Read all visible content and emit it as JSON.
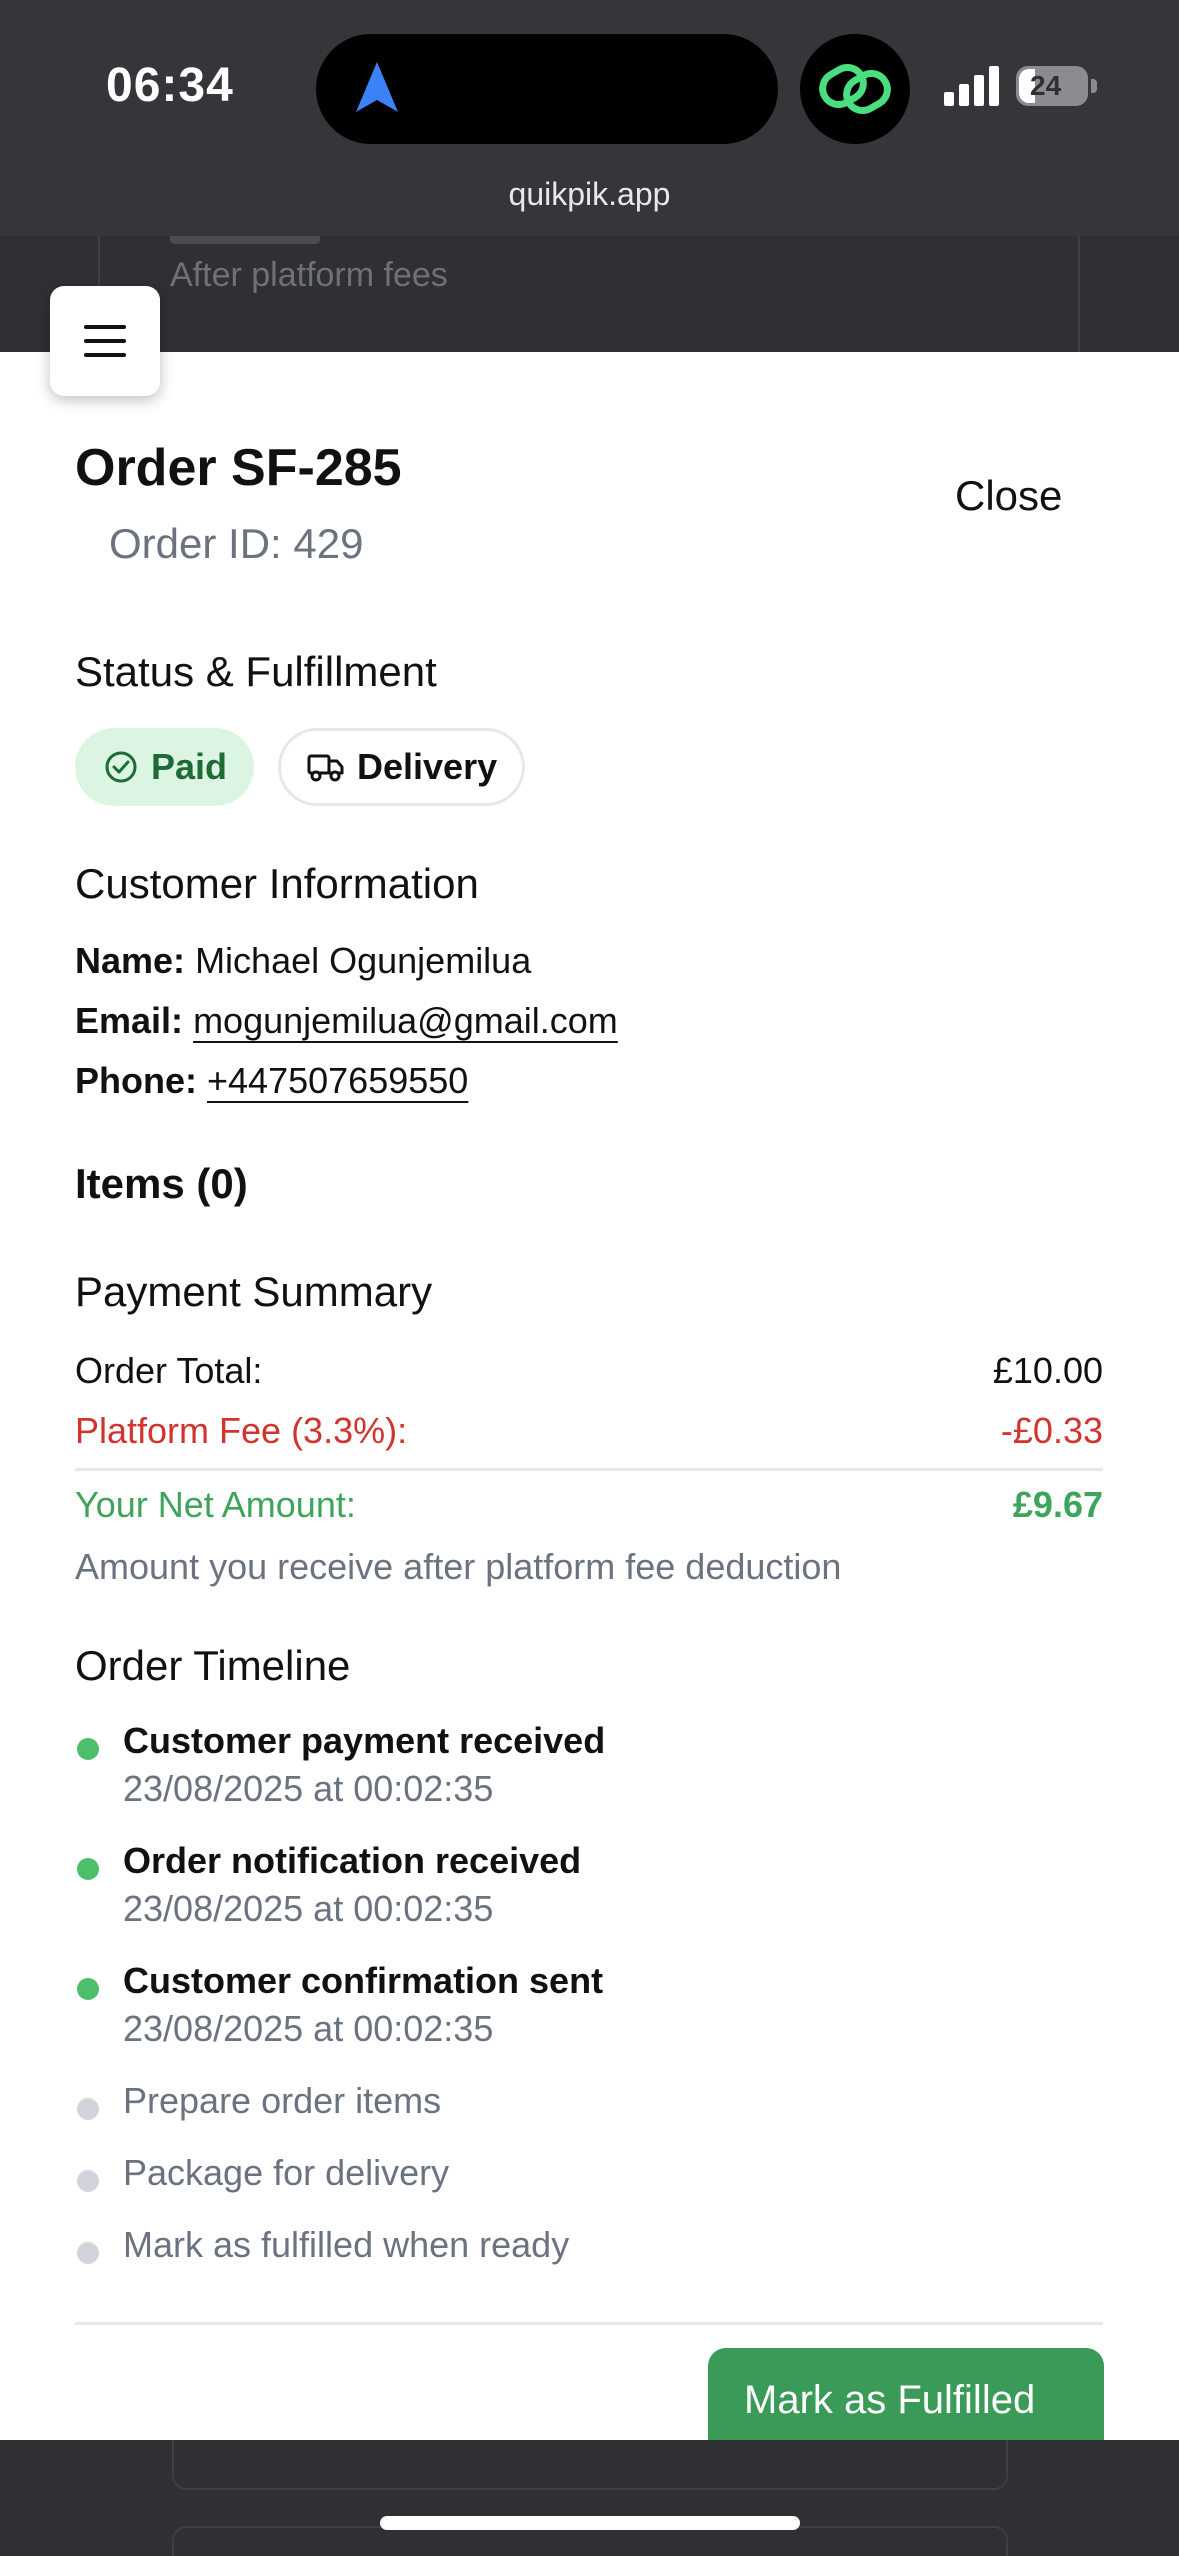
{
  "status_bar": {
    "time": "06:34",
    "battery": "24",
    "url": "quikpik.app"
  },
  "background_page": {
    "card_subtitle": "After platform fees"
  },
  "modal": {
    "title": "Order SF-285",
    "order_id": "Order ID: 429",
    "close_label": "Close",
    "status_section": {
      "heading": "Status & Fulfillment",
      "payment_badge": "Paid",
      "fulfillment_badge": "Delivery"
    },
    "customer_section": {
      "heading": "Customer Information",
      "name_label": "Name:",
      "name_value": "Michael Ogunjemilua",
      "email_label": "Email:",
      "email_value": "mogunjemilua@gmail.com",
      "phone_label": "Phone:",
      "phone_value": "+447507659550"
    },
    "items_heading": "Items (0)",
    "payment_section": {
      "heading": "Payment Summary",
      "order_total_label": "Order Total:",
      "order_total_value": "£10.00",
      "platform_fee_label": "Platform Fee (3.3%):",
      "platform_fee_value": "-£0.33",
      "net_label": "Your Net Amount:",
      "net_value": "£9.67",
      "note": "Amount you receive after platform fee deduction"
    },
    "timeline_section": {
      "heading": "Order Timeline",
      "completed": [
        {
          "title": "Customer payment received",
          "time": "23/08/2025 at 00:02:35"
        },
        {
          "title": "Order notification received",
          "time": "23/08/2025 at 00:02:35"
        },
        {
          "title": "Customer confirmation sent",
          "time": "23/08/2025 at 00:02:35"
        }
      ],
      "pending": [
        "Prepare order items",
        "Package for delivery",
        "Mark as fulfilled when ready"
      ]
    },
    "fulfill_button": "Mark as Fulfilled"
  },
  "colors": {
    "success_green": "#3a9a57",
    "net_green": "#3fa45b",
    "fee_red": "#d0342c",
    "muted_gray": "#6b7280",
    "paid_badge_bg": "#dcf5e3",
    "completed_dot": "#4cbf6a",
    "pending_dot": "#d1d5db"
  }
}
